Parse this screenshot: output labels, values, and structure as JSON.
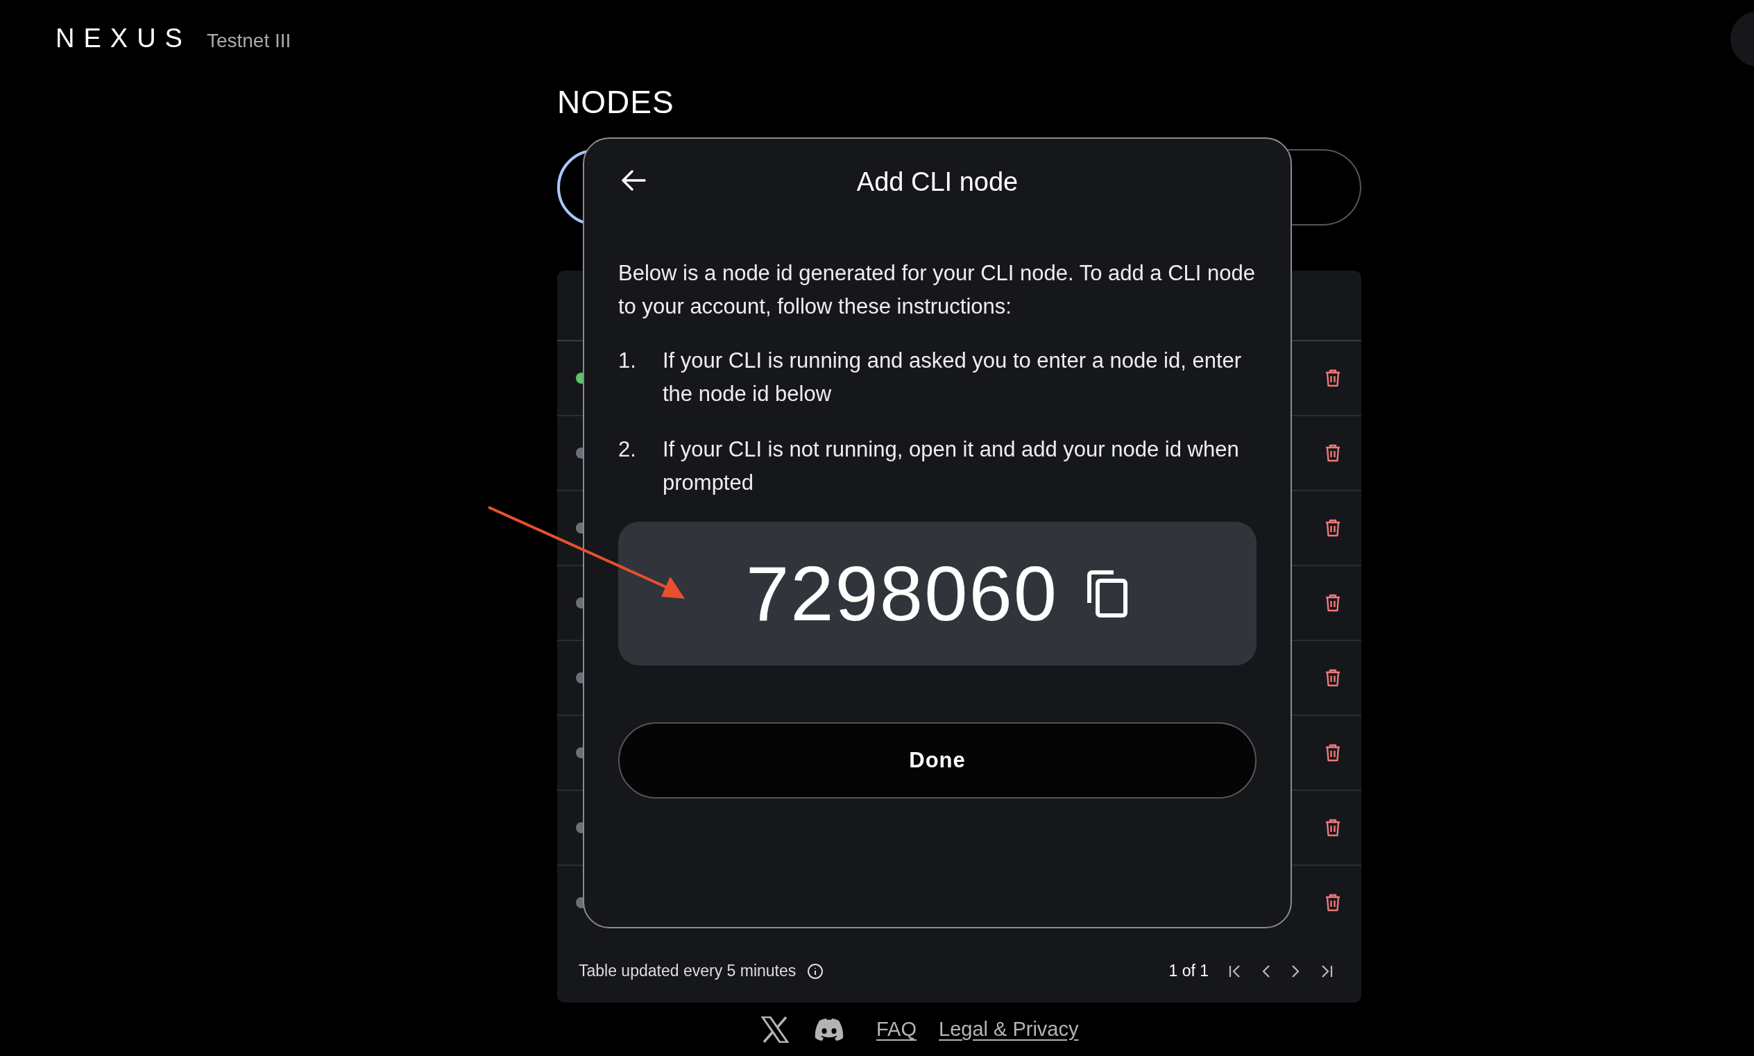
{
  "header": {
    "logo": "NEXUS",
    "network": "Testnet III"
  },
  "page_title": "NODES",
  "table": {
    "rows": [
      {
        "color": "#5cc46a"
      },
      {
        "color": "#6b6f78"
      },
      {
        "color": "#6b6f78"
      },
      {
        "color": "#6b6f78"
      },
      {
        "color": "#6b6f78"
      },
      {
        "color": "#6b6f78"
      },
      {
        "color": "#6b6f78"
      },
      {
        "color": "#6b6f78"
      }
    ],
    "note": "Table updated every 5 minutes",
    "pagination": "1 of 1"
  },
  "footer_links": [
    "FAQ",
    "Legal & Privacy"
  ],
  "modal": {
    "title": "Add CLI node",
    "intro": "Below is a node id generated for your CLI node. To add a CLI node to your account, follow these instructions:",
    "steps": [
      {
        "number": "1.",
        "text": "If your CLI is running and asked you to enter a node id, enter the node id below"
      },
      {
        "number": "2.",
        "text": "If your CLI is not running, open it and add your node id when prompted"
      }
    ],
    "node_id": "7298060",
    "done_label": "Done"
  }
}
